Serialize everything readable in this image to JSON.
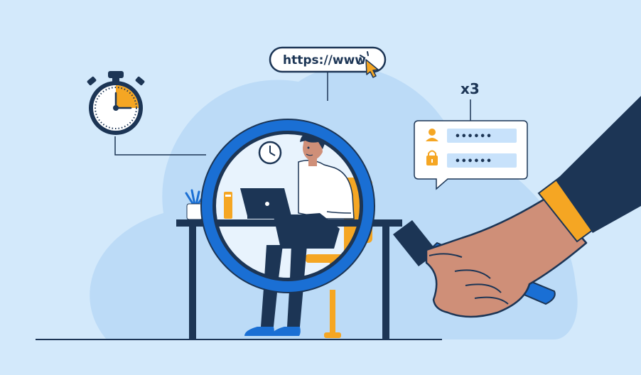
{
  "url_bar": {
    "text": "https://www."
  },
  "login_attempts": {
    "label": "x3"
  },
  "login_form": {
    "username_value": "••••••",
    "password_value": "••••••"
  },
  "stopwatch": {
    "elapsed_fraction": 0.25
  },
  "colors": {
    "background": "#d3e9fb",
    "blob": "#bcdbf7",
    "navy": "#1c3555",
    "brand_blue": "#1a6fd4",
    "orange": "#f5a623",
    "skin": "#cf8f78"
  },
  "icons": [
    "stopwatch-icon",
    "cursor-icon",
    "user-icon",
    "lock-icon",
    "wall-clock-icon",
    "magnifying-glass-icon",
    "laptop-icon",
    "plant-icon"
  ]
}
